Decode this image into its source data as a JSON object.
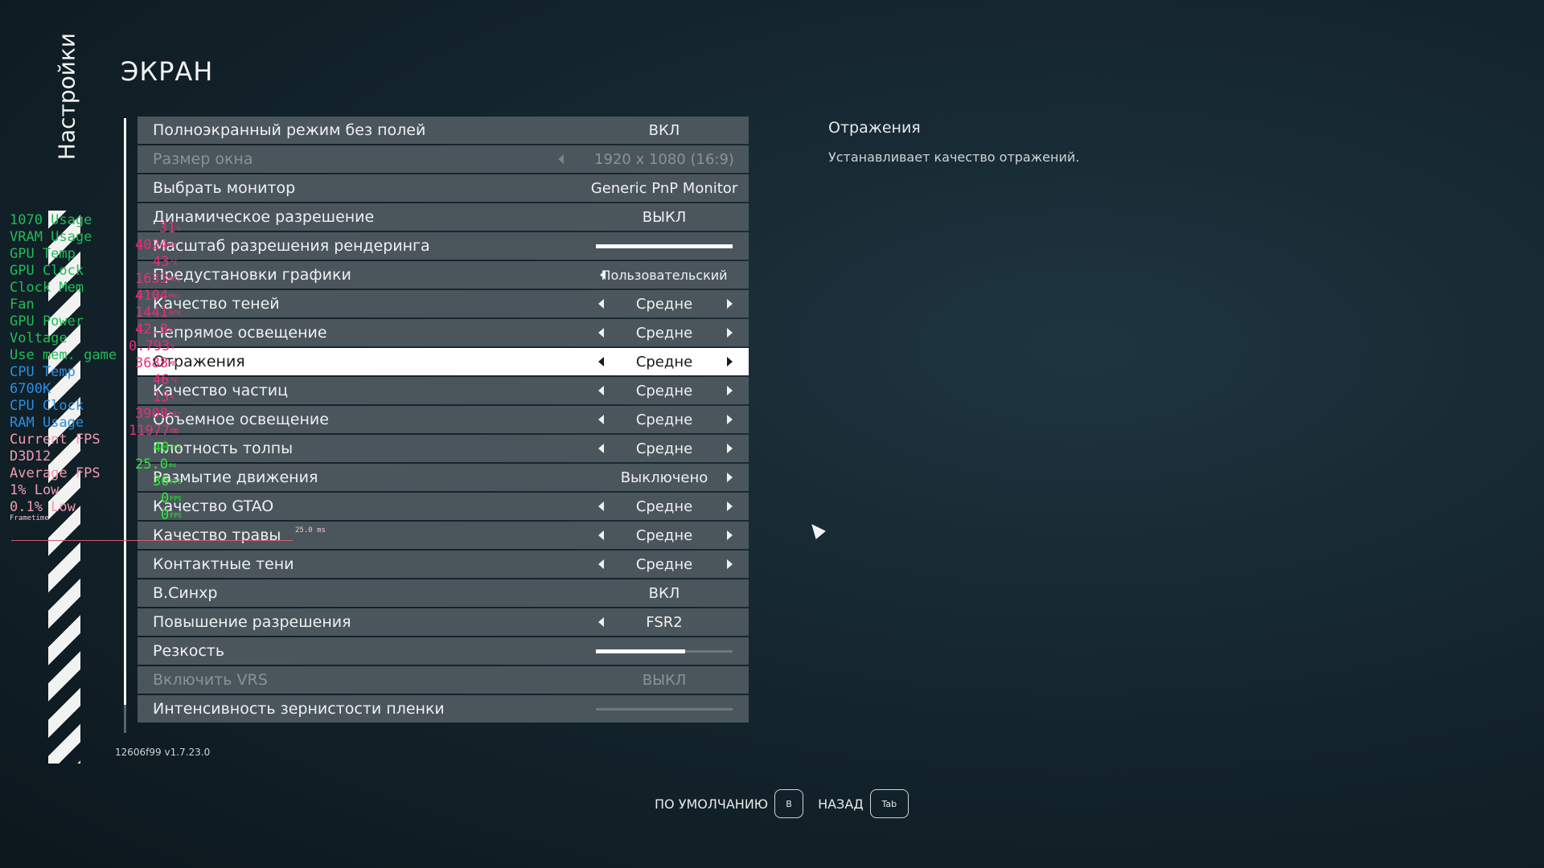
{
  "sidebar": {
    "title": "Настройки"
  },
  "page": {
    "title": "ЭКРАН"
  },
  "settings": [
    {
      "label": "Полноэкранный режим без полей",
      "value": "ВКЛ",
      "type": "toggle"
    },
    {
      "label": "Размер окна",
      "value": "1920 x 1080 (16:9)",
      "type": "disabled-select"
    },
    {
      "label": "Выбрать монитор",
      "value": "Generic PnP Monitor",
      "type": "toggle"
    },
    {
      "label": "Динамическое разрешение",
      "value": "ВЫКЛ",
      "type": "toggle"
    },
    {
      "label": "Масштаб разрешения рендеринга",
      "value": 1.0,
      "type": "slider"
    },
    {
      "label": "Предустановки графики",
      "value": "Пользовательский",
      "type": "preset"
    },
    {
      "label": "Качество теней",
      "value": "Средне",
      "type": "select"
    },
    {
      "label": "Непрямое освещение",
      "value": "Средне",
      "type": "select"
    },
    {
      "label": "Отражения",
      "value": "Средне",
      "type": "select",
      "selected": true
    },
    {
      "label": "Качество частиц",
      "value": "Средне",
      "type": "select"
    },
    {
      "label": "Объемное освещение",
      "value": "Средне",
      "type": "select"
    },
    {
      "label": "Плотность толпы",
      "value": "Средне",
      "type": "select"
    },
    {
      "label": "Размытие движения",
      "value": "Выключено",
      "type": "select-right"
    },
    {
      "label": "Качество GTAO",
      "value": "Средне",
      "type": "select"
    },
    {
      "label": "Качество травы",
      "value": "Средне",
      "type": "select"
    },
    {
      "label": "Контактные тени",
      "value": "Средне",
      "type": "select"
    },
    {
      "label": "В.Синхр",
      "value": "ВКЛ",
      "type": "toggle"
    },
    {
      "label": "Повышение разрешения",
      "value": "FSR2",
      "type": "select-left"
    },
    {
      "label": "Резкость",
      "value": 0.65,
      "type": "slider"
    },
    {
      "label": "Включить VRS",
      "value": "ВЫКЛ",
      "type": "disabled-toggle"
    },
    {
      "label": "Интенсивность зернистости пленки",
      "value": 0.0,
      "type": "slider"
    }
  ],
  "description": {
    "title": "Отражения",
    "text": "Устанавливает качество отражений."
  },
  "version": "12606f99 v1.7.23.0",
  "footer": {
    "default_label": "ПО УМОЛЧАНИЮ",
    "default_key": "B",
    "back_label": "НАЗАД",
    "back_key": "Tab"
  },
  "overlay": {
    "labels": [
      {
        "text": "1070 Usage",
        "color": "#1fbd57"
      },
      {
        "text": "VRAM Usage",
        "color": "#1fbd57"
      },
      {
        "text": "GPU Temp",
        "color": "#1fbd57"
      },
      {
        "text": "GPU Clock",
        "color": "#1fbd57"
      },
      {
        "text": "Clock Mem",
        "color": "#1fbd57"
      },
      {
        "text": "Fan",
        "color": "#1fbd57"
      },
      {
        "text": "GPU Power",
        "color": "#1fbd57"
      },
      {
        "text": "Voltage",
        "color": "#1fbd57"
      },
      {
        "text": "Use mem. game",
        "color": "#1fbd57"
      },
      {
        "text": "CPU Temp",
        "color": "#2a8fe0"
      },
      {
        "text": "6700K",
        "color": "#2a8fe0"
      },
      {
        "text": "CPU Clock",
        "color": "#2a8fe0"
      },
      {
        "text": "RAM Usage",
        "color": "#2a8fe0"
      },
      {
        "text": "Current FPS",
        "color": "#f29aae"
      },
      {
        "text": "D3D12",
        "color": "#f29aae"
      },
      {
        "text": "Average FPS",
        "color": "#f29aae"
      },
      {
        "text": "1% Low",
        "color": "#f29aae"
      },
      {
        "text": "0.1% Low",
        "color": "#f29aae"
      }
    ],
    "values": [
      {
        "text": "31",
        "unit": "%",
        "color": "#ee2a7a",
        "offset": 38
      },
      {
        "text": "4024",
        "unit": "MB",
        "color": "#ee2a7a",
        "offset": 8
      },
      {
        "text": "43",
        "unit": "°C",
        "color": "#ee2a7a",
        "offset": 30
      },
      {
        "text": "1633",
        "unit": "MHz",
        "color": "#ee2a7a",
        "offset": 8
      },
      {
        "text": "4104",
        "unit": "MHz",
        "color": "#ee2a7a",
        "offset": 8
      },
      {
        "text": "1441",
        "unit": "RPM",
        "color": "#ee2a7a",
        "offset": 8
      },
      {
        "text": "42.8",
        "unit": "W",
        "color": "#ee2a7a",
        "offset": 8
      },
      {
        "text": "0.793",
        "unit": "V",
        "color": "#ee2a7a",
        "offset": -2
      },
      {
        "text": "3688",
        "unit": "MB",
        "color": "#ee2a7a",
        "offset": 8
      },
      {
        "text": "46",
        "unit": "°C",
        "color": "#ee2a7a",
        "offset": 30
      },
      {
        "text": "13",
        "unit": "%",
        "color": "#ee2a7a",
        "offset": 30
      },
      {
        "text": "3908",
        "unit": "MHz",
        "color": "#ee2a7a",
        "offset": 8
      },
      {
        "text": "11977",
        "unit": "MB",
        "color": "#ee2a7a",
        "offset": -2
      },
      {
        "text": "40",
        "unit": "FPS",
        "color": "#2ee836",
        "offset": 30
      },
      {
        "text": "25.0",
        "unit": "ms",
        "color": "#2ee836",
        "offset": 8
      },
      {
        "text": "36",
        "unit": "FPS",
        "color": "#2ee836",
        "offset": 30
      },
      {
        "text": "0",
        "unit": "FPS",
        "color": "#2ee836",
        "offset": 40
      },
      {
        "text": "0",
        "unit": "FPS",
        "color": "#2ee836",
        "offset": 40
      }
    ],
    "frametime_label": "Frametime",
    "frametime_value": "25.0 ms"
  }
}
